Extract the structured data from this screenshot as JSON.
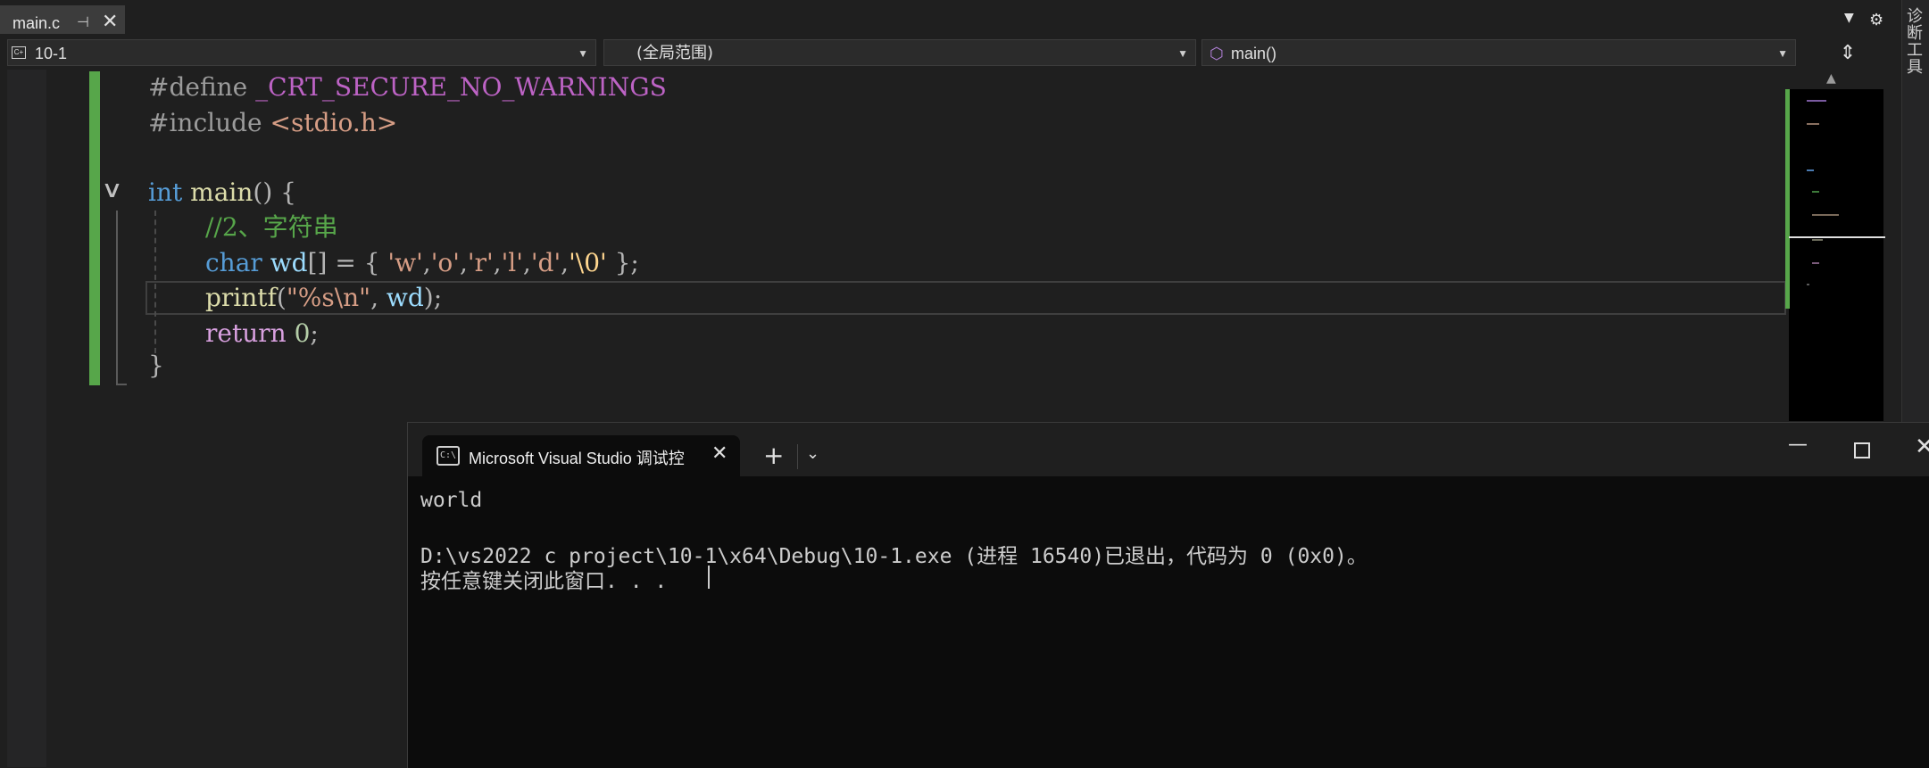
{
  "tab": {
    "title": "main.c",
    "pin_icon": "pin-icon",
    "close_icon": "close-icon"
  },
  "side_panel": {
    "label": "诊断工具"
  },
  "navbar": {
    "project": "10-1",
    "scope": "(全局范围)",
    "function": "main()"
  },
  "code": {
    "line1": {
      "directive": "#define",
      "name": "_CRT_SECURE_NO_WARNINGS"
    },
    "line2": {
      "directive": "#include",
      "header": "<stdio.h>"
    },
    "line4": {
      "type": "int",
      "name": "main",
      "parens": "()",
      "brace": "{"
    },
    "line5": {
      "comment": "//2、字符串"
    },
    "line6": {
      "type": "char",
      "var": "wd",
      "rest_a": "[] = { ",
      "chars": [
        "'w'",
        "'o'",
        "'r'",
        "'l'",
        "'d'"
      ],
      "sep": ",",
      "escape": "'\\0'",
      "end": " };"
    },
    "line7": {
      "fn": "printf",
      "open": "(",
      "str": "\"%s\\n\"",
      "mid": ", ",
      "var": "wd",
      "end": ");"
    },
    "line8": {
      "kw": "return",
      "num": "0",
      "end": ";"
    },
    "line9": {
      "brace": "}"
    }
  },
  "terminal": {
    "tab_title": "Microsoft Visual Studio 调试控",
    "icon_text": "C:\\",
    "output": [
      "world",
      "",
      "D:\\vs2022 c project\\10-1\\x64\\Debug\\10-1.exe (进程 16540)已退出，代码为 0 (0x0)。",
      "按任意键关闭此窗口. . ."
    ]
  },
  "colors": {
    "accent_green": "#57a64a",
    "keyword": "#569cd6",
    "string": "#d69d85",
    "comment": "#57a64a",
    "macro": "#bd63c5"
  }
}
